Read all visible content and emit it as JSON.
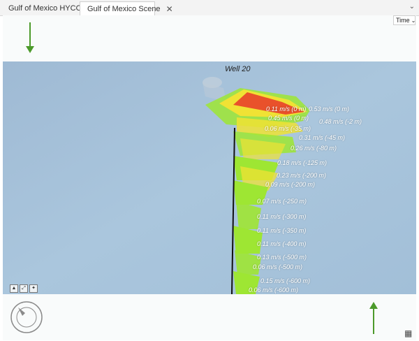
{
  "tabs": [
    {
      "label": "Gulf of Mexico HYCOM",
      "icon": "map-icon"
    },
    {
      "label": "Gulf of Mexico Scene",
      "icon": "globe-scene-icon"
    }
  ],
  "time_select": {
    "value": "Time"
  },
  "scene": {
    "well_label": "Well 20",
    "velocity_labels": [
      "0.11 m/s (0 m)",
      "0.53 m/s (0 m)",
      "0.45 m/s (0 m)",
      "0.48 m/s (-2 m)",
      "0.06 m/s (-35 m)",
      "0.31 m/s (-45 m)",
      "0.26 m/s (-80 m)",
      "0.18 m/s (-125 m)",
      "0.23 m/s (-200 m)",
      "0.09 m/s (-200 m)",
      "0.07 m/s (-250 m)",
      "0.11 m/s (-300 m)",
      "0.11 m/s (-350 m)",
      "0.11 m/s (-400 m)",
      "0.13 m/s (-500 m)",
      "0.06 m/s (-500 m)",
      "0.15 m/s (-600 m)",
      "0.06 m/s (-600 m)"
    ]
  },
  "colors": {
    "arrow": "#4c9a2a",
    "water": "#a8c4db",
    "high": "#e8412a",
    "mid": "#f0e234",
    "low": "#9ee633"
  }
}
